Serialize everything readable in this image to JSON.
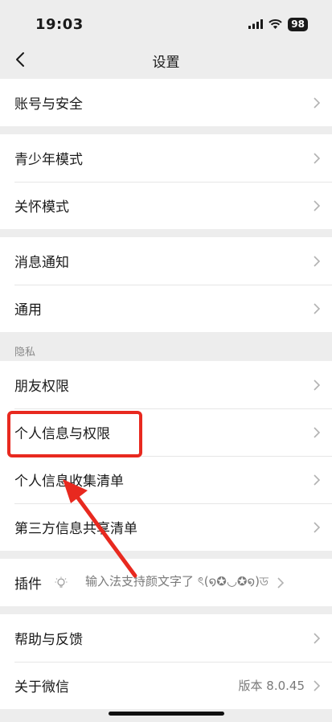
{
  "status_bar": {
    "time": "19:03",
    "battery": "98"
  },
  "nav": {
    "title": "设置"
  },
  "groups": {
    "g1": [
      {
        "label": "账号与安全"
      }
    ],
    "g2": [
      {
        "label": "青少年模式"
      },
      {
        "label": "关怀模式"
      }
    ],
    "g3": [
      {
        "label": "消息通知"
      },
      {
        "label": "通用"
      }
    ],
    "privacy_header": "隐私",
    "g4": [
      {
        "label": "朋友权限"
      },
      {
        "label": "个人信息与权限"
      },
      {
        "label": "个人信息收集清单"
      },
      {
        "label": "第三方信息共享清单"
      }
    ],
    "g5": [
      {
        "label": "插件",
        "value": "输入法支持颜文字了 ৎ(໑✪◡✪໑)ড"
      }
    ],
    "g6": [
      {
        "label": "帮助与反馈"
      },
      {
        "label": "关于微信",
        "value": "版本 8.0.45"
      }
    ]
  },
  "colors": {
    "highlight": "#e8291f",
    "background": "#ededed"
  }
}
